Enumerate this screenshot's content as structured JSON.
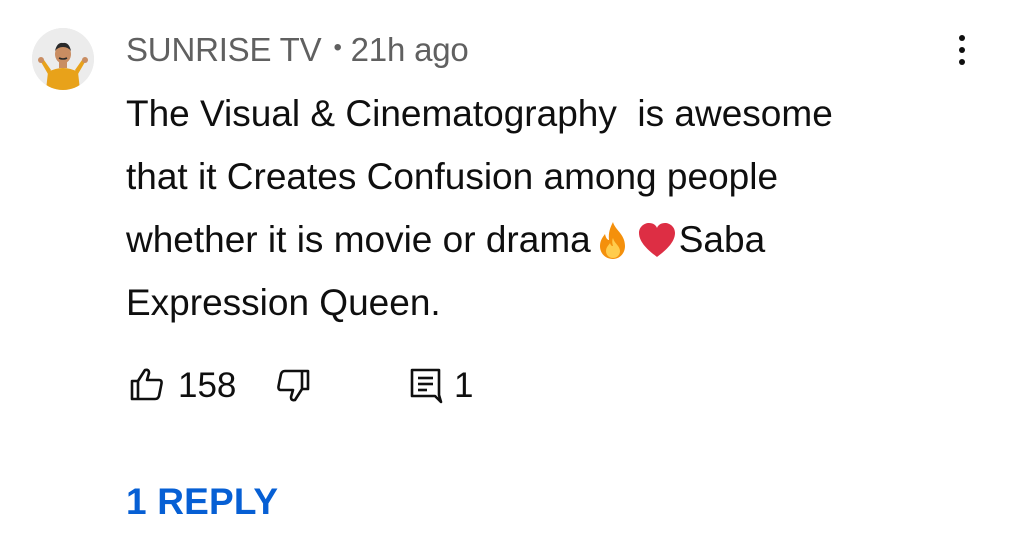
{
  "comment": {
    "author": "SUNRISE TV",
    "separator": "•",
    "timestamp": "21h ago",
    "text_part1": "The Visual & Cinematography  is awesome\nthat it Creates Confusion among people\nwhether it is movie or drama",
    "emojis": [
      "fire-emoji",
      "red-heart-emoji"
    ],
    "text_part2": "Saba\nExpression Queen.",
    "like_count": "158",
    "reply_count": "1",
    "replies_link": "1 REPLY"
  },
  "icons": {
    "like": "thumbs-up-icon",
    "dislike": "thumbs-down-icon",
    "reply": "comment-reply-icon",
    "more": "more-vert-icon"
  },
  "colors": {
    "author_meta": "#606060",
    "text": "#0f0f0f",
    "link": "#065fd4"
  }
}
